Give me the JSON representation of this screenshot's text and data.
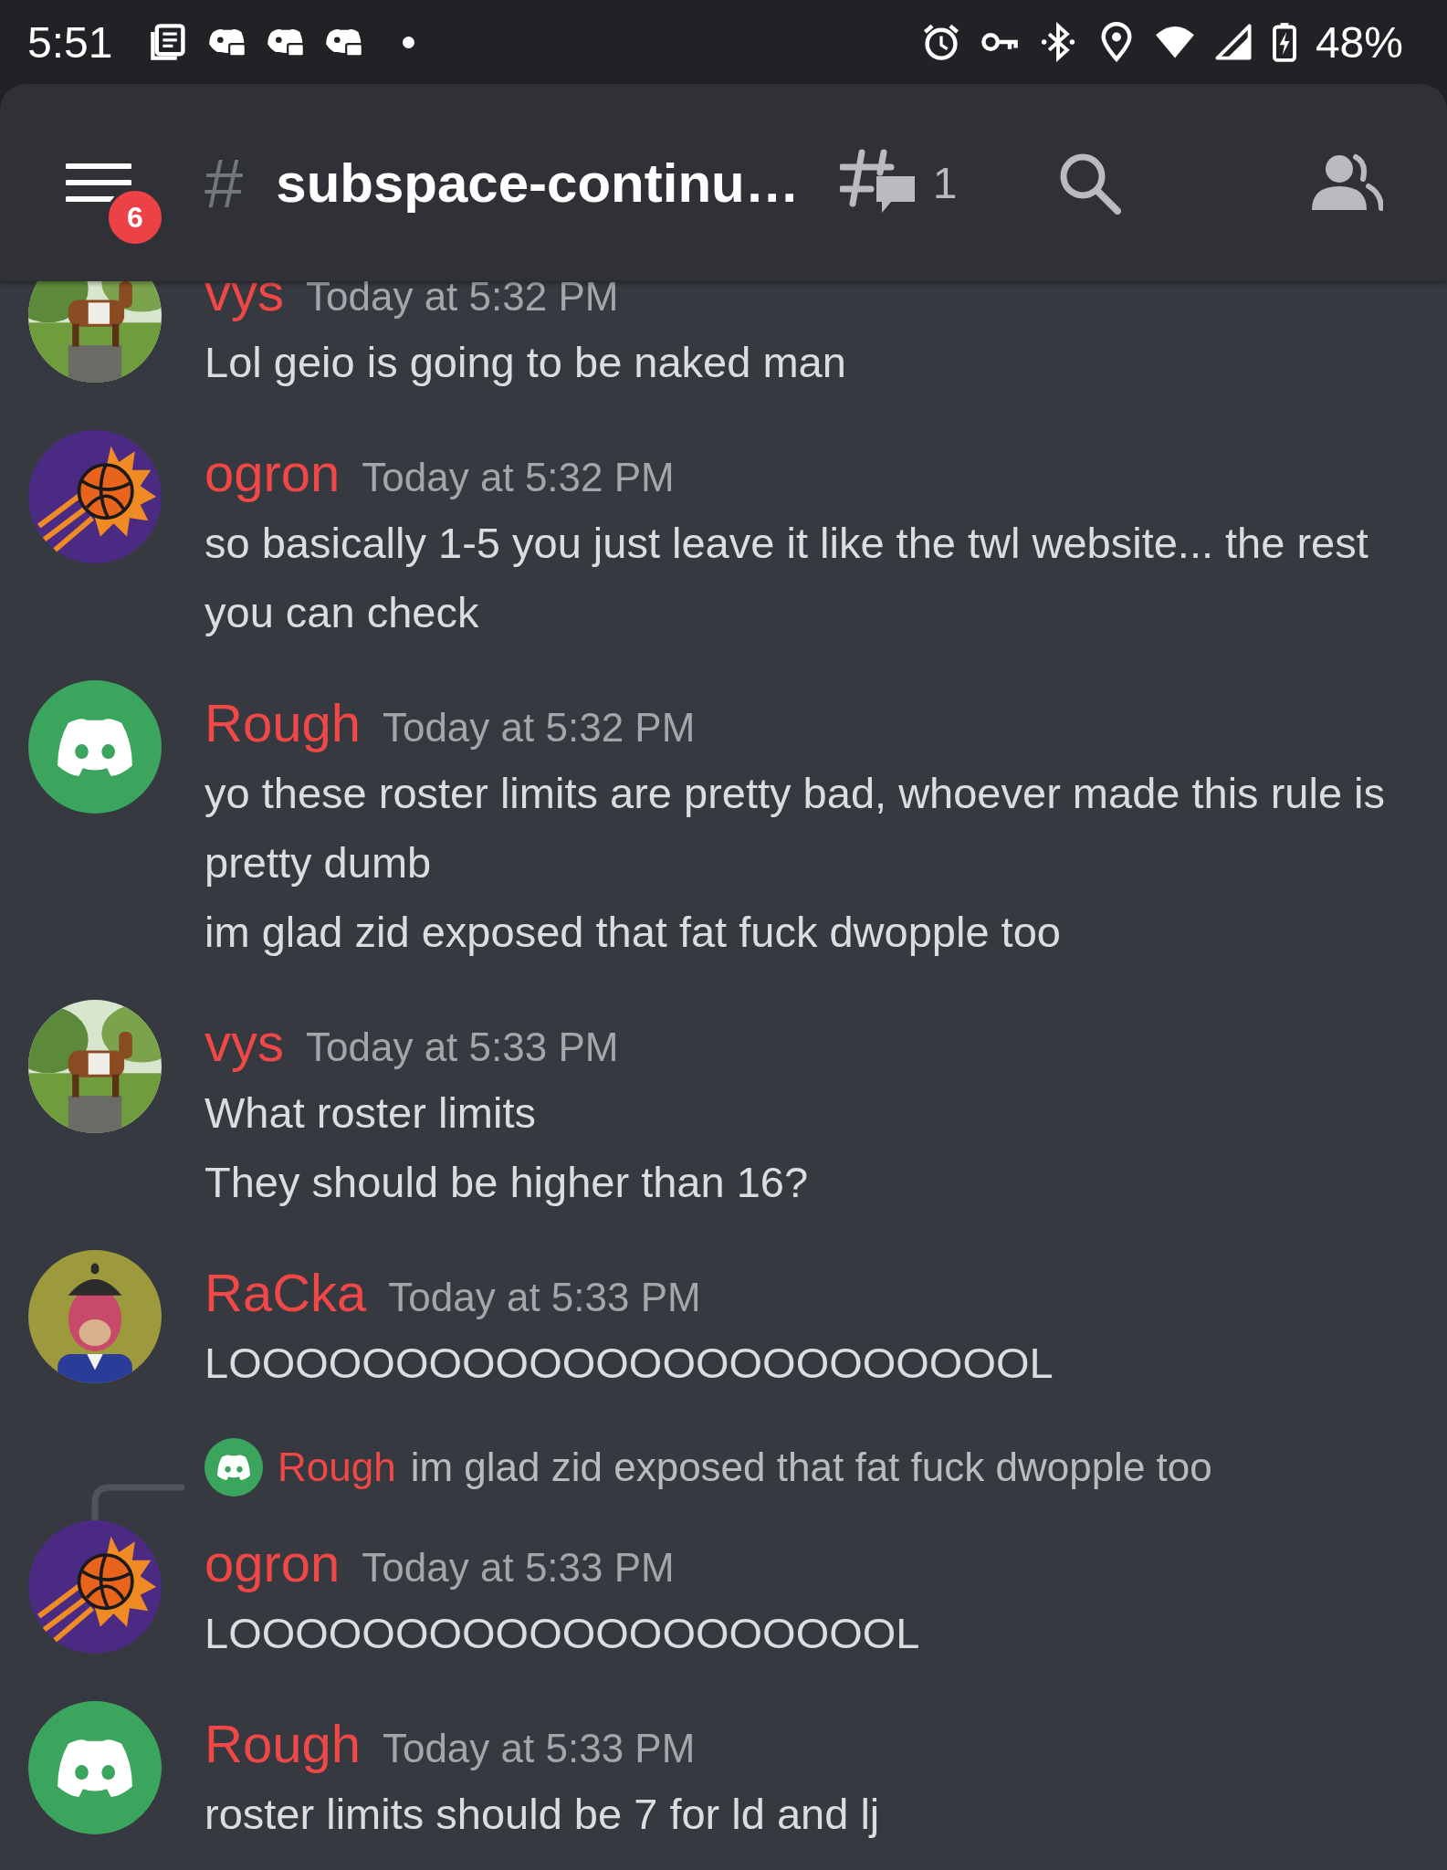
{
  "status_bar": {
    "time": "5:51",
    "battery": "48%"
  },
  "header": {
    "unread_badge": "6",
    "channel_prefix": "#",
    "channel_name": "subspace-continu…",
    "threads_count": "1"
  },
  "messages": [
    {
      "author": "vys",
      "avatar": {
        "kind": "goat"
      },
      "timestamp": "Today at 5:32 PM",
      "lines": [
        "Lol geio is going to be naked man"
      ]
    },
    {
      "author": "ogron",
      "avatar": {
        "kind": "basketball"
      },
      "timestamp": "Today at 5:32 PM",
      "lines": [
        "so basically 1-5 you just leave it like the twl website... the rest you can check"
      ]
    },
    {
      "author": "Rough",
      "avatar": {
        "kind": "gamepad"
      },
      "timestamp": "Today at 5:32 PM",
      "lines": [
        "yo these roster limits are pretty bad, whoever made this rule is pretty dumb",
        "im glad zid exposed that fat fuck dwopple too"
      ]
    },
    {
      "author": "vys",
      "avatar": {
        "kind": "goat"
      },
      "timestamp": "Today at 5:33 PM",
      "lines": [
        "What roster limits",
        "They should be higher than 16?"
      ]
    },
    {
      "author": "RaCka",
      "avatar": {
        "kind": "figure"
      },
      "timestamp": "Today at 5:33 PM",
      "lines": [
        "LOOOOOOOOOOOOOOOOOOOOOOOOL"
      ]
    },
    {
      "author": "ogron",
      "avatar": {
        "kind": "basketball"
      },
      "timestamp": "Today at 5:33 PM",
      "reply": {
        "author": "Rough",
        "avatar": {
          "kind": "gamepad"
        },
        "text": "im glad zid exposed that fat fuck dwopple too"
      },
      "lines": [
        "LOOOOOOOOOOOOOOOOOOOOL"
      ]
    },
    {
      "author": "Rough",
      "avatar": {
        "kind": "gamepad"
      },
      "timestamp": "Today at 5:33 PM",
      "lines": [
        "roster limits should be 7 for ld and lj"
      ]
    }
  ]
}
